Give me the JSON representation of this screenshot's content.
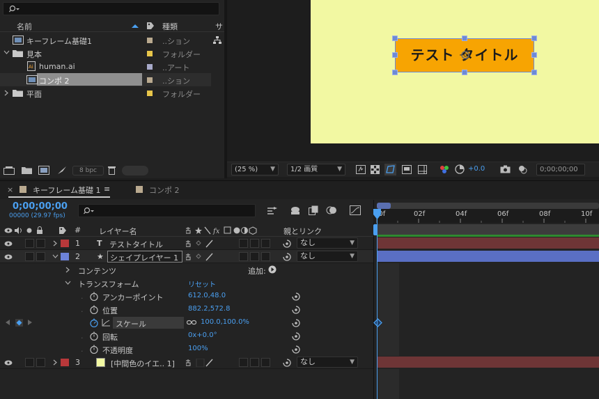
{
  "project": {
    "search_placeholder": "",
    "columns": {
      "name": "名前",
      "type": "種類",
      "size": "サ"
    },
    "items": [
      {
        "name": "キーフレーム基礎1",
        "type": "..ション",
        "color": "#b9a98f"
      },
      {
        "name": "見本",
        "type": "フォルダー",
        "color": "#e8c64a"
      },
      {
        "name": "human.ai",
        "type": "..アート",
        "color": "#a7a9c9"
      },
      {
        "name": "コンポ 2",
        "type": "..ション",
        "color": "#b9a98f"
      },
      {
        "name": "平面",
        "type": "フォルダー",
        "color": "#e8c64a"
      }
    ],
    "bpc": "8 bpc"
  },
  "viewer": {
    "shape_text": "テスト タイトル",
    "zoom": "(25 %)",
    "resolution": "1/2 画質",
    "exposure": "+0.0",
    "timecode": "0;00;00;00",
    "colors": {
      "canvas": "#f2f8a2",
      "shape": "#f7a402"
    }
  },
  "timeline": {
    "tabs": [
      {
        "label": "キーフレーム基礎 1"
      },
      {
        "label": "コンポ 2"
      }
    ],
    "menu_icon": "≡",
    "timecode": "0;00;00;00",
    "frames_fps": "00000 (29.97 fps)",
    "columns": {
      "num": "#",
      "layer_name": "レイヤー名",
      "parent": "親とリンク"
    },
    "ruler": [
      "00f",
      "02f",
      "04f",
      "06f",
      "08f",
      "10f"
    ],
    "layers": [
      {
        "index": "1",
        "name": "テストタイトル",
        "parent": "なし",
        "label_color": "#b8383a",
        "type": "T"
      },
      {
        "index": "2",
        "name": "シェイプレイヤー 1",
        "parent": "なし",
        "label_color": "#6d83d8",
        "type": "★"
      },
      {
        "index": "3",
        "name": "[中間色のイエ.. 1]",
        "parent": "なし",
        "label_color": "#b8383a",
        "swatch": "#f2f8a2"
      }
    ],
    "contents": {
      "label": "コンテンツ",
      "add": "追加:"
    },
    "transform": {
      "label": "トランスフォーム",
      "reset": "リセット"
    },
    "properties": [
      {
        "name": "アンカーポイント",
        "value": "612.0,48.0"
      },
      {
        "name": "位置",
        "value": "882.2,572.8"
      },
      {
        "name": "スケール",
        "value": "100.0,100.0%"
      },
      {
        "name": "回転",
        "value": "0x+0.0°"
      },
      {
        "name": "不透明度",
        "value": "100%"
      }
    ]
  }
}
